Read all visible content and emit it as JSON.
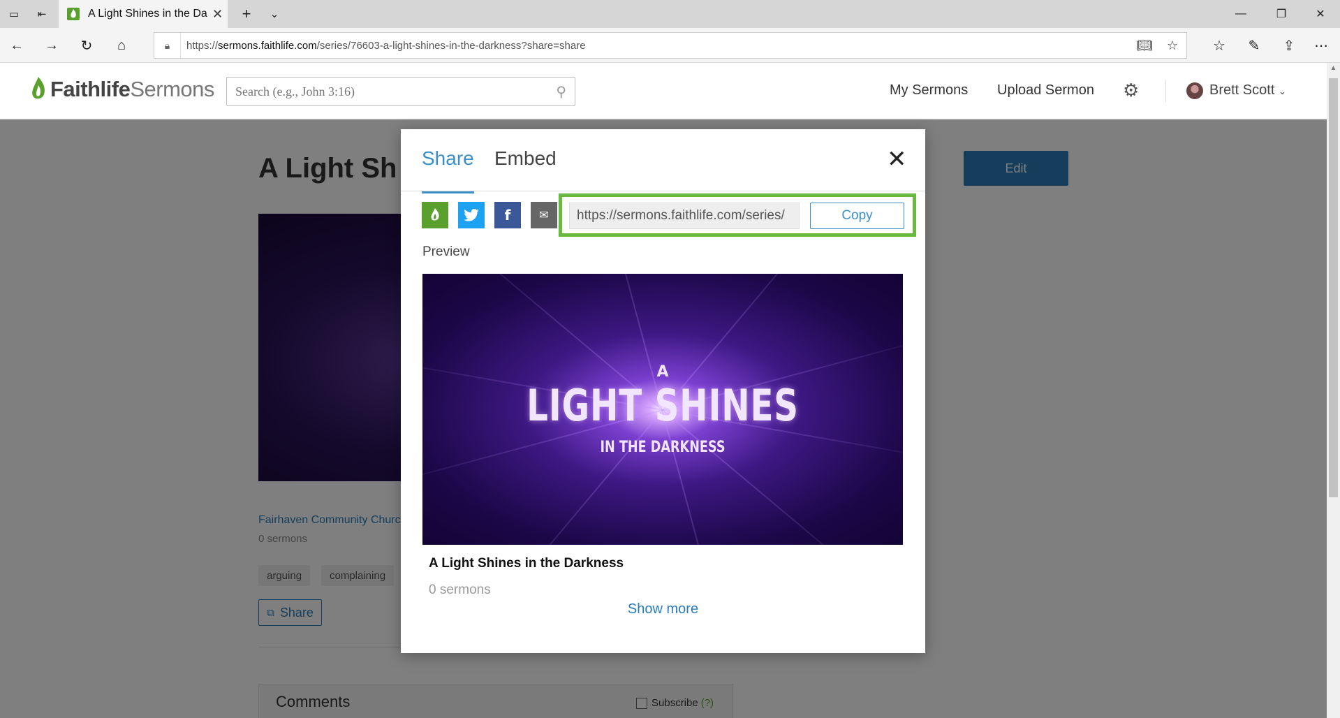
{
  "browser": {
    "tab_title": "A Light Shines in the Da",
    "url_prefix": "https://",
    "url_host": "sermons.faithlife.com",
    "url_path": "/series/76603-a-light-shines-in-the-darkness?share=share"
  },
  "header": {
    "logo_a": "Faithlife",
    "logo_b": " Sermons",
    "search_placeholder": "Search (e.g., John 3:16)",
    "my_sermons": "My Sermons",
    "upload_sermon": "Upload Sermon",
    "user_name": "Brett Scott"
  },
  "page": {
    "title": "A Light Sh",
    "edit_label": "Edit",
    "church": "Fairhaven Community Church",
    "sermon_count": "0 sermons",
    "tags": [
      "arguing",
      "complaining"
    ],
    "share_label": "Share",
    "comments_title": "Comments",
    "subscribe_label": "Subscribe",
    "subscribe_help": "(?)"
  },
  "modal": {
    "tab_share": "Share",
    "tab_embed": "Embed",
    "share_url": "https://sermons.faithlife.com/series/",
    "copy_label": "Copy",
    "preview_label": "Preview",
    "preview_art": {
      "line1": "A",
      "line2": "LIGHT SHINES",
      "line3": "IN THE DARKNESS"
    },
    "preview_title": "A Light Shines in the Darkness",
    "preview_count": "0 sermons",
    "show_more": "Show more"
  },
  "colors": {
    "accent_blue": "#3a8fc9",
    "faithlife_green": "#5aa02c",
    "highlight_green": "#6ab93f",
    "twitter": "#1da1f2",
    "facebook": "#3b5998"
  }
}
